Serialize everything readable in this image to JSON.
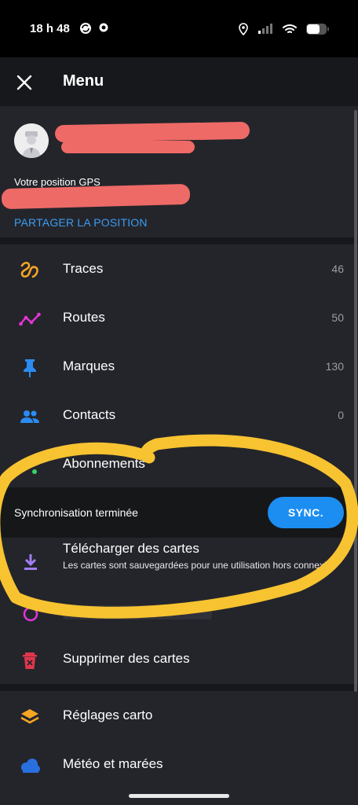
{
  "status_bar": {
    "time": "18 h 48",
    "icons": [
      "sync-icon",
      "gear-icon",
      "location-icon",
      "signal-icon",
      "wifi-icon",
      "battery-icon"
    ]
  },
  "app_bar": {
    "title": "Menu",
    "close_icon": "close-icon"
  },
  "profile": {
    "gps_label": "Votre position GPS",
    "share_label": "PARTAGER LA POSITION"
  },
  "menu": {
    "items": [
      {
        "label": "Traces",
        "count": "46",
        "icon": "trace-icon"
      },
      {
        "label": "Routes",
        "count": "50",
        "icon": "route-icon"
      },
      {
        "label": "Marques",
        "count": "130",
        "icon": "pin-icon"
      },
      {
        "label": "Contacts",
        "count": "0",
        "icon": "contacts-icon"
      },
      {
        "label": "Abonnements",
        "count": "",
        "icon": "subscriptions-icon"
      }
    ]
  },
  "sync": {
    "status": "Synchronisation terminée",
    "button": "SYNC."
  },
  "download": {
    "title": "Télécharger des cartes",
    "subtitle": "Les cartes sont sauvegardées pour une utilisation hors connexion"
  },
  "menu2": {
    "items": [
      {
        "label": "Supprimer des cartes",
        "icon": "trash-icon"
      },
      {
        "label": "Réglages carto",
        "icon": "layers-icon"
      },
      {
        "label": "Météo et marées",
        "icon": "weather-icon"
      }
    ]
  },
  "colors": {
    "accent_blue": "#1c8ef2",
    "link_blue": "#3b9cf2",
    "highlight_yellow": "#f7c331",
    "redaction_red": "#ee6a66",
    "background": "#24252b"
  }
}
